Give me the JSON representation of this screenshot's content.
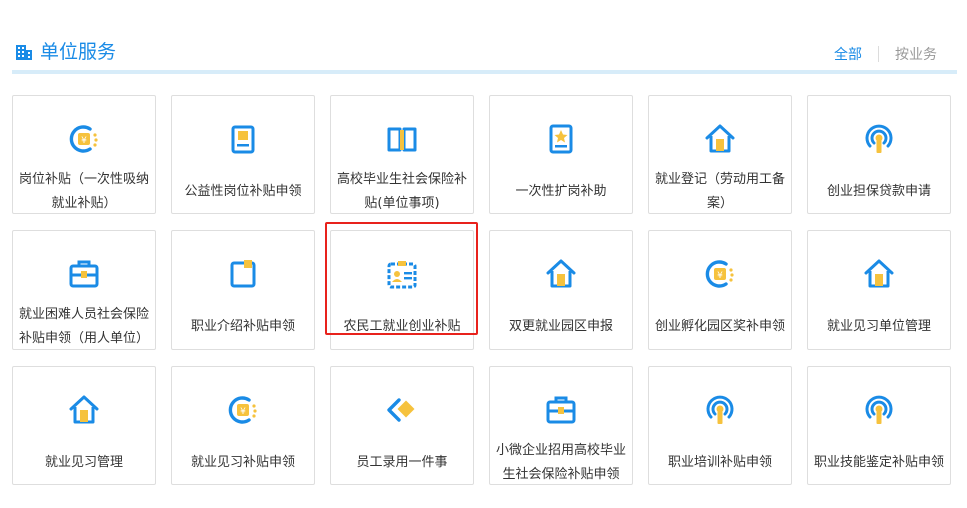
{
  "header": {
    "title": "单位服务",
    "filter_all": "全部",
    "filter_business": "按业务"
  },
  "colors": {
    "accent": "#1a8be6",
    "icon_yellow": "#f6c23d",
    "highlight": "#e8221c"
  },
  "services": [
    {
      "label": "岗位补贴（一次性吸纳就业补贴）",
      "icon": "coin-icon"
    },
    {
      "label": "公益性岗位补贴申领",
      "icon": "clipboard-icon"
    },
    {
      "label": "高校毕业生社会保险补贴(单位事项)",
      "icon": "book-icon"
    },
    {
      "label": "一次性扩岗补助",
      "icon": "document-star-icon"
    },
    {
      "label": "就业登记（劳动用工备案）",
      "icon": "house-icon"
    },
    {
      "label": "创业担保贷款申请",
      "icon": "signal-icon"
    },
    {
      "label": "就业困难人员社会保险补贴申领（用人单位）",
      "icon": "briefcase-icon"
    },
    {
      "label": "职业介绍补贴申领",
      "icon": "folder-icon"
    },
    {
      "label": "农民工就业创业补贴",
      "icon": "id-card-icon"
    },
    {
      "label": "双更就业园区申报",
      "icon": "house-icon"
    },
    {
      "label": "创业孵化园区奖补申领",
      "icon": "coin-icon"
    },
    {
      "label": "就业见习单位管理",
      "icon": "house-icon"
    },
    {
      "label": "就业见习管理",
      "icon": "house-icon"
    },
    {
      "label": "就业见习补贴申领",
      "icon": "coin-icon"
    },
    {
      "label": "员工录用一件事",
      "icon": "diamond-icon"
    },
    {
      "label": "小微企业招用高校毕业生社会保险补贴申领",
      "icon": "briefcase-icon"
    },
    {
      "label": "职业培训补贴申领",
      "icon": "signal-icon"
    },
    {
      "label": "职业技能鉴定补贴申领",
      "icon": "signal-icon"
    }
  ]
}
